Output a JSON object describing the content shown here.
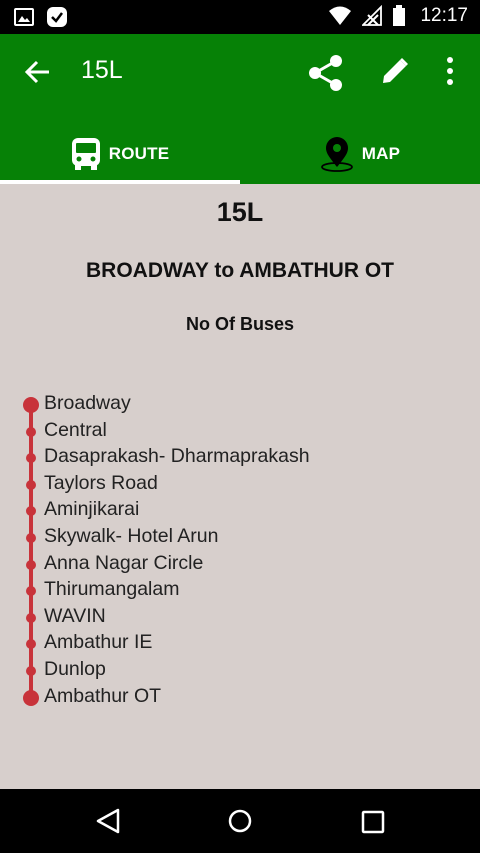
{
  "status_bar": {
    "time": "12:17",
    "icons": [
      "image-icon",
      "check-icon",
      "wifi-icon",
      "no-signal-icon",
      "battery-icon"
    ]
  },
  "toolbar": {
    "title": "15L",
    "actions": [
      "back-arrow-icon",
      "share-icon",
      "edit-icon",
      "more-vert-icon"
    ],
    "color": "#068106"
  },
  "tabs": [
    {
      "label": "ROUTE",
      "icon": "bus-icon",
      "selected": true
    },
    {
      "label": "MAP",
      "icon": "map-pin-icon",
      "selected": false
    }
  ],
  "route": {
    "number": "15L",
    "description": "BROADWAY to AMBATHUR OT",
    "buses_label": "No Of Buses",
    "line_color": "#c8333a",
    "stops": [
      "Broadway",
      "Central",
      "Dasaprakash- Dharmaprakash",
      "Taylors Road",
      "Aminjikarai",
      "Skywalk- Hotel Arun",
      "Anna Nagar Circle",
      "Thirumangalam",
      "WAVIN",
      "Ambathur IE",
      "Dunlop",
      "Ambathur OT"
    ]
  },
  "nav_bar": {
    "buttons": [
      "nav-back-icon",
      "nav-home-icon",
      "nav-recents-icon"
    ]
  }
}
